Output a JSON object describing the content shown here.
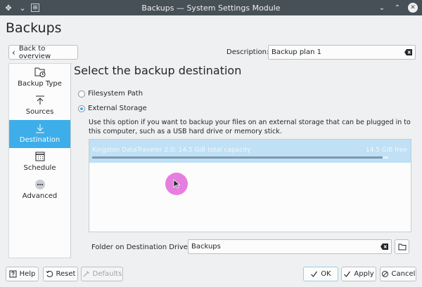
{
  "window": {
    "title": "Backups — System Settings Module",
    "pin_glyph": "✥",
    "chevron_glyph": "⌄",
    "menu_glyph": "⊞",
    "minimize_glyph": "⌄",
    "maximize_glyph": "⌃",
    "close_glyph": "✕"
  },
  "page": {
    "title": "Backups"
  },
  "toolbar": {
    "back_label": "Back to overview",
    "back_glyph": "‹",
    "description_label": "Description:",
    "description_value": "Backup plan 1"
  },
  "sidebar": {
    "items": [
      {
        "label": "Backup Type",
        "icon": "folder-clock-icon"
      },
      {
        "label": "Sources",
        "icon": "upload-icon"
      },
      {
        "label": "Destination",
        "icon": "download-icon",
        "active": true
      },
      {
        "label": "Schedule",
        "icon": "calendar-icon"
      },
      {
        "label": "Advanced",
        "icon": "more-icon"
      }
    ]
  },
  "destination": {
    "title": "Select the backup destination",
    "option_filesystem": "Filesystem Path",
    "option_external": "External Storage",
    "selected": "External Storage",
    "help_text": "Use this option if you want to backup your files on an external storage that can be plugged in to this computer, such as a USB hard drive or memory stick.",
    "drives": [
      {
        "name": "Kingston DataTraveler 2.0: 14.5 GiB total capacity",
        "free": "14.5 GiB free",
        "used_fraction": 0.02
      }
    ],
    "folder_label": "Folder on Destination Drive:",
    "folder_value": "Backups"
  },
  "buttons": {
    "help": "Help",
    "reset": "Reset",
    "defaults": "Defaults",
    "ok": "OK",
    "apply": "Apply",
    "cancel": "Cancel"
  },
  "colors": {
    "accent": "#3daee9",
    "titlebar": "#475057",
    "selection_row": "#bfe0f5",
    "cursor_highlight": "#e67ee0"
  }
}
